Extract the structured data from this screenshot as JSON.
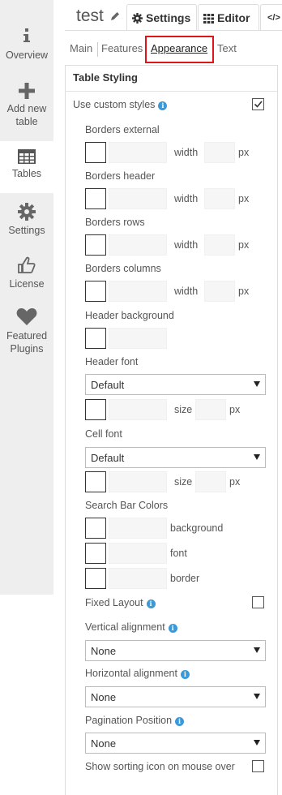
{
  "sidebar": {
    "items": [
      {
        "label": "Overview",
        "icon": "info-icon"
      },
      {
        "label": "Add new table",
        "icon": "plus-icon"
      },
      {
        "label": "Tables",
        "icon": "table-icon"
      },
      {
        "label": "Settings",
        "icon": "gear-icon"
      },
      {
        "label": "License",
        "icon": "thumbs-up-icon"
      },
      {
        "label": "Featured Plugins",
        "icon": "heart-icon"
      }
    ]
  },
  "header": {
    "title": "test",
    "tabs": [
      {
        "label": "Settings",
        "icon": "gear-icon",
        "active": true
      },
      {
        "label": "Editor",
        "icon": "grid-icon"
      },
      {
        "label": "</>",
        "icon": "code-icon"
      }
    ]
  },
  "subtabs": [
    "Main",
    "Features",
    "Appearance",
    "Text"
  ],
  "panel": {
    "heading": "Table Styling",
    "use_custom_styles": {
      "label": "Use custom styles",
      "checked": true
    },
    "borders": [
      {
        "label": "Borders external",
        "width_label": "width",
        "unit": "px"
      },
      {
        "label": "Borders header",
        "width_label": "width",
        "unit": "px"
      },
      {
        "label": "Borders rows",
        "width_label": "width",
        "unit": "px"
      },
      {
        "label": "Borders columns",
        "width_label": "width",
        "unit": "px"
      }
    ],
    "header_background": {
      "label": "Header background"
    },
    "header_font": {
      "label": "Header font",
      "value": "Default",
      "size_label": "size",
      "unit": "px"
    },
    "cell_font": {
      "label": "Cell font",
      "value": "Default",
      "size_label": "size",
      "unit": "px"
    },
    "search_bar": {
      "label": "Search Bar Colors",
      "items": [
        "background",
        "font",
        "border"
      ]
    },
    "fixed_layout": {
      "label": "Fixed Layout",
      "checked": false
    },
    "vertical_alignment": {
      "label": "Vertical alignment",
      "value": "None"
    },
    "horizontal_alignment": {
      "label": "Horizontal alignment",
      "value": "None"
    },
    "pagination_position": {
      "label": "Pagination Position",
      "value": "None"
    },
    "sorting_icon": {
      "label": "Show sorting icon on mouse over",
      "checked": false
    }
  },
  "colors": {
    "accent": "#3a99d8",
    "highlight": "#e0151a",
    "sidebar_bg": "#eeeeee"
  }
}
